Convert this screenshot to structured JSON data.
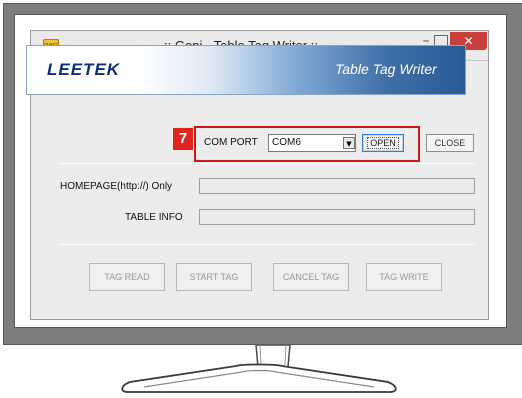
{
  "window": {
    "title": ":: Geni - Table Tag Writer ::",
    "app_icon_label": "geni",
    "minimize_glyph": "–",
    "close_glyph": "✕"
  },
  "banner": {
    "logo": "LEETEK",
    "title": "Table Tag Writer"
  },
  "step_badge": "7",
  "com_port": {
    "label": "COM PORT",
    "value": "COM6",
    "open_label": "OPEN",
    "close_label": "CLOSE"
  },
  "fields": {
    "homepage_label": "HOMEPAGE(http://) Only",
    "homepage_value": "",
    "table_info_label": "TABLE INFO",
    "table_info_value": ""
  },
  "buttons": {
    "tag_read": "TAG READ",
    "start_tag": "START TAG",
    "cancel_tag": "CANCEL TAG",
    "tag_write": "TAG WRITE"
  },
  "colors": {
    "highlight": "#d01818",
    "badge": "#e0241f",
    "close_button": "#c8403c",
    "banner_blue": "#2a5a96",
    "logo_navy": "#0d2f78"
  },
  "icons": {
    "dropdown": "chevron-down-icon",
    "window_close": "close-icon"
  }
}
